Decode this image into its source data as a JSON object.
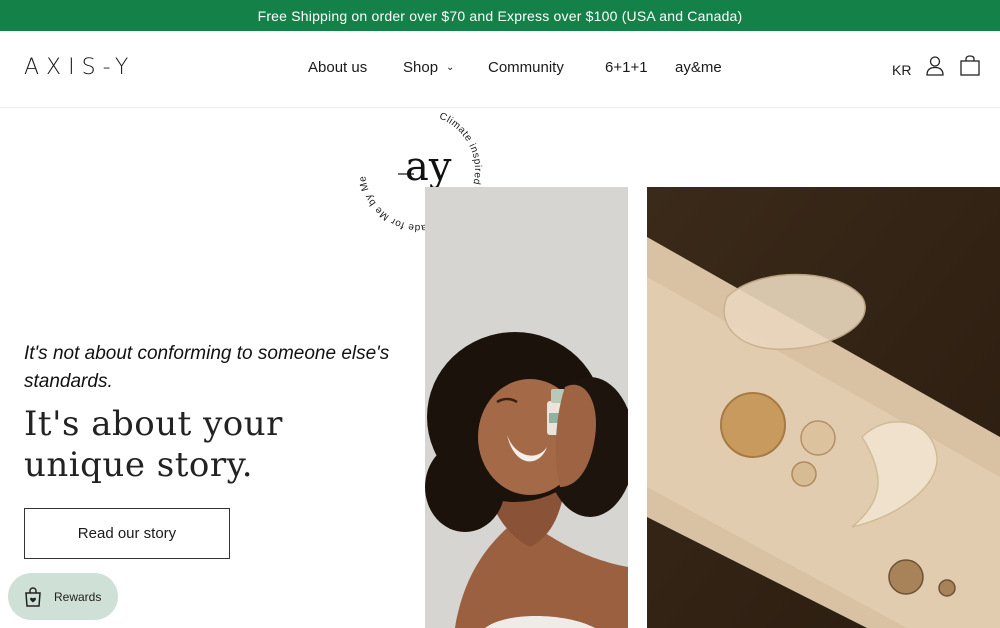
{
  "announcement": {
    "text": "Free Shipping on order over $70 and Express over $100 (USA and Canada)",
    "bg_color": "#138148"
  },
  "header": {
    "logo": "AXIS-Y",
    "nav": [
      {
        "label": "About us"
      },
      {
        "label": "Shop",
        "has_dropdown": true
      },
      {
        "label": "Community"
      },
      {
        "label": "6+1+1"
      },
      {
        "label": "ay&me"
      }
    ],
    "language": "KR",
    "icons": [
      "user-icon",
      "cart-icon"
    ]
  },
  "badge": {
    "monogram": "ay",
    "ring_text": "Climate inspired skincare • Made for Me by Me"
  },
  "hero": {
    "subtitle": "It's not about conforming to someone else's standards.",
    "title": "It's about your unique story.",
    "button_label": "Read our story"
  },
  "rewards": {
    "label": "Rewards",
    "bg_color": "#cfe0d6"
  }
}
